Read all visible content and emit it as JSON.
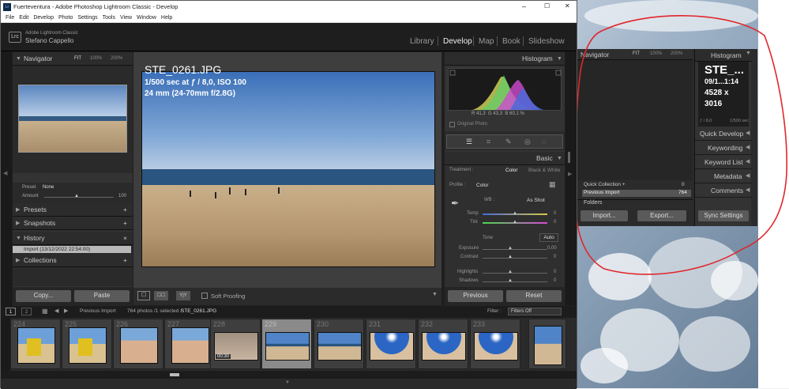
{
  "window": {
    "title": "Fuerteventura - Adobe Photoshop Lightroom Classic - Develop",
    "min": "–",
    "max": "☐",
    "close": "✕"
  },
  "menu": [
    "File",
    "Edit",
    "Develop",
    "Photo",
    "Settings",
    "Tools",
    "View",
    "Window",
    "Help"
  ],
  "identity": {
    "badge": "Lrc",
    "app": "Adobe Lightroom Classic",
    "user": "Stefano Cappello"
  },
  "modules": [
    "Library",
    "Develop",
    "Map",
    "Book",
    "Slideshow"
  ],
  "navigator": {
    "title": "Navigator",
    "zoom": [
      "FIT",
      "100%",
      "200%"
    ]
  },
  "preset_row": {
    "preset_label": "Preset",
    "preset_value": "None",
    "amount_label": "Amount",
    "amount_value": "100"
  },
  "left_panels": [
    "Presets",
    "Snapshots",
    "History",
    "Collections"
  ],
  "history_item": "Import (13/12/2022 22:54:00)",
  "left_buttons": {
    "copy": "Copy...",
    "paste": "Paste"
  },
  "photo_info": {
    "filename": "STE_0261.JPG",
    "exposure": "1/500 sec at ƒ / 8,0, ISO 100",
    "lens": "24 mm (24-70mm f/2.8G)"
  },
  "toolbar": {
    "soft_proofing": "Soft Proofing",
    "view_btns": [
      "☐",
      "☐☐",
      "Y|Y"
    ]
  },
  "histogram": {
    "title": "Histogram",
    "r_label": "R",
    "r": "41,3",
    "g_label": "G",
    "g": "43,3",
    "b_label": "B",
    "b": "60,1",
    "pct": "%",
    "original": "Original Photo"
  },
  "basic": {
    "title": "Basic",
    "treatment_label": "Treatment :",
    "color": "Color",
    "bw": "Black & White",
    "profile_label": "Profile :",
    "profile": "Color",
    "wb_label": "WB :",
    "wb": "As Shot",
    "temp": "Temp",
    "tint": "Tint",
    "tone": "Tone",
    "auto": "Auto",
    "exposure": "Exposure",
    "exposure_val": "0,00",
    "contrast": "Contrast",
    "highlights": "Highlights",
    "shadows": "Shadows",
    "zero": "0"
  },
  "right_buttons": {
    "previous": "Previous",
    "reset": "Reset"
  },
  "filmstrip": {
    "pages": [
      "1",
      "2"
    ],
    "source": "Previous Import",
    "count": "764 photos /1 selected /",
    "file": "STE_0261.JPG",
    "filter_label": "Filter :",
    "filter_value": "Filters Off",
    "numbers": [
      "224",
      "225",
      "226",
      "227",
      "228",
      "229",
      "230",
      "231",
      "232",
      "233"
    ],
    "video_time": "00:30"
  },
  "copy_panel": {
    "navigator": "Navigator",
    "zoom": [
      "FIT",
      "100%",
      "200%"
    ],
    "histogram": "Histogram",
    "filename": "STE_...",
    "date": "09/1...1:14",
    "size1": "4528 x",
    "size2": "3016",
    "f": "ƒ / 8,0",
    "sec": "1/500 sec",
    "panels": [
      "Quick Develop",
      "Keywording",
      "Keyword List",
      "Metadata",
      "Comments"
    ],
    "quick_collection": "Quick Collection +",
    "quick_count": "0",
    "prev_import": "Previous Import",
    "prev_count": "764",
    "folders": "Folders",
    "import": "Import...",
    "export": "Export...",
    "sync": "Sync Settings"
  },
  "colors": {
    "annotation": "#e0262b",
    "accent": "#d9d9d9"
  }
}
